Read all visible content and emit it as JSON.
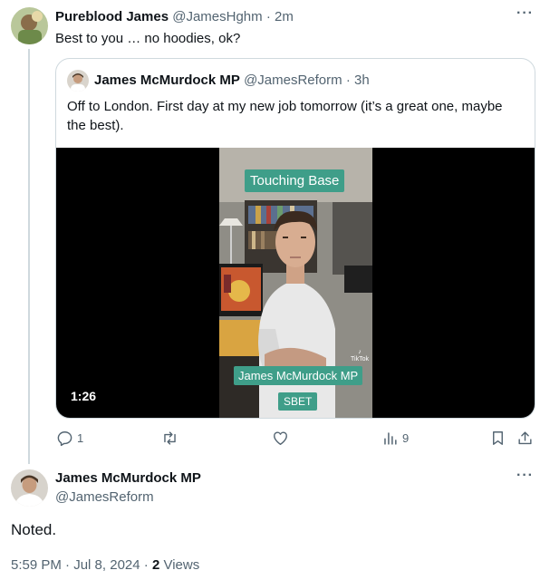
{
  "reply_tweet": {
    "author_name": "Pureblood James",
    "handle": "@JamesHghm",
    "separator": "·",
    "time": "2m",
    "text": "Best to you … no hoodies, ok?",
    "more": "···"
  },
  "quoted_tweet": {
    "author_name": "James McMurdock MP",
    "handle": "@JamesReform",
    "separator": "·",
    "time": "3h",
    "text": "Off to London. First day at my new job tomorrow (it’s a great one, maybe the best).",
    "video": {
      "duration": "1:26",
      "caption_top": "Touching Base",
      "caption_name": "James McMurdock MP",
      "caption_bottom": "SBET",
      "watermark": "TikTok"
    }
  },
  "actions": {
    "reply_count": "1",
    "retweet_count": "",
    "like_count": "",
    "views_count": "9"
  },
  "main_tweet": {
    "author_name": "James McMurdock MP",
    "handle": "@JamesReform",
    "text": "Noted.",
    "time": "5:59 PM",
    "date": "Jul 8, 2024",
    "separator": "·",
    "views_count": "2",
    "views_label": "Views",
    "more": "···"
  },
  "colors": {
    "text": "#0f1419",
    "muted": "#536471",
    "border": "#cfd9de",
    "caption_bg": "#3f9e89"
  }
}
